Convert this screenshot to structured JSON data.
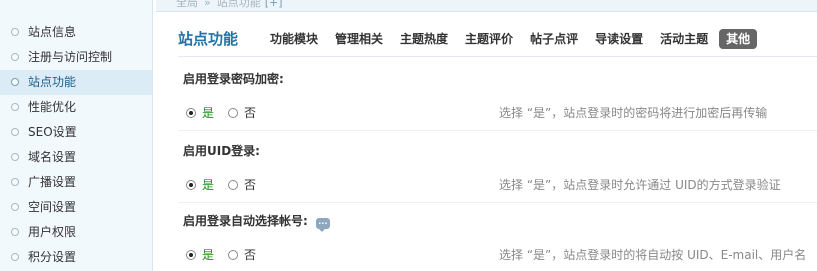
{
  "breadcrumb": {
    "home": "全局",
    "current": "站点功能",
    "marker": "[+]"
  },
  "sidebar": {
    "items": [
      {
        "label": "站点信息"
      },
      {
        "label": "注册与访问控制"
      },
      {
        "label": "站点功能",
        "active": true
      },
      {
        "label": "性能优化"
      },
      {
        "label": "SEO设置"
      },
      {
        "label": "域名设置"
      },
      {
        "label": "广播设置"
      },
      {
        "label": "空间设置"
      },
      {
        "label": "用户权限"
      },
      {
        "label": "积分设置"
      }
    ]
  },
  "header": {
    "title": "站点功能",
    "tabs": [
      {
        "label": "功能模块"
      },
      {
        "label": "管理相关"
      },
      {
        "label": "主题热度"
      },
      {
        "label": "主题评价"
      },
      {
        "label": "帖子点评"
      },
      {
        "label": "导读设置"
      },
      {
        "label": "活动主题"
      },
      {
        "label": "其他",
        "active": true
      }
    ]
  },
  "settings": [
    {
      "label": "启用登录密码加密:",
      "yes": "是",
      "no": "否",
      "selected": "yes",
      "tip": "选择 “是”，站点登录时的密码将进行加密后再传输"
    },
    {
      "label": "启用UID登录:",
      "yes": "是",
      "no": "否",
      "selected": "yes",
      "tip": "选择 “是”，站点登录时允许通过  UID的方式登录验证"
    },
    {
      "label": "启用登录自动选择帐号:",
      "yes": "是",
      "no": "否",
      "selected": "yes",
      "help": true,
      "tip": "选择 “是”，站点登录时的将自动按  UID、E-mail、用户名"
    }
  ],
  "colors": {
    "accent": "#2074a8",
    "yes_text": "#1a8c1a",
    "active_tab": "#666666"
  }
}
